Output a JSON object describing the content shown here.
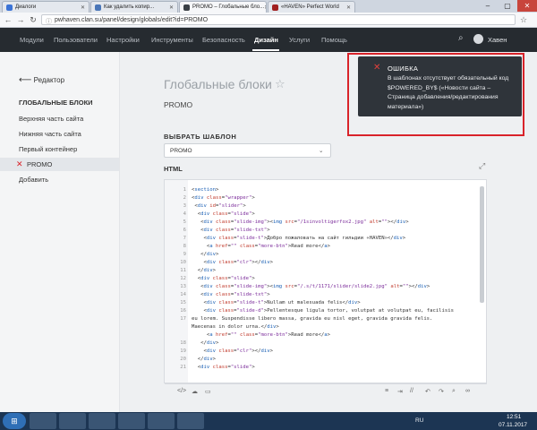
{
  "browser": {
    "tabs": [
      {
        "title": "Диалоги",
        "color": "#3b73d6"
      },
      {
        "title": "Как удалить копир...",
        "color": "#4a76b8"
      },
      {
        "title": "PROMO – Глобальные бло...",
        "color": "#3a3f45"
      },
      {
        "title": "«HAVEN» Perfect World",
        "color": "#a02020"
      }
    ],
    "url": "pwhaven.clan.su/panel/design/globals/edit?id=PROMO"
  },
  "site_nav": {
    "items": [
      "Модули",
      "Пользователи",
      "Настройки",
      "Инструменты",
      "Безопасность",
      "Дизайн",
      "Услуги",
      "Помощь"
    ],
    "active_index": 5,
    "user_name": "Хавен"
  },
  "sidebar": {
    "back_label": "Редактор",
    "section_title": "ГЛОБАЛЬНЫЕ БЛОКИ",
    "items": [
      "Верхняя часть сайта",
      "Нижняя часть сайта",
      "Первый контейнер",
      "PROMO",
      "Добавить"
    ],
    "active_index": 3
  },
  "main": {
    "title": "Глобальные блоки",
    "subtitle": "PROMO",
    "template_label": "ВЫБРАТЬ ШАБЛОН",
    "template_value": "PROMO",
    "html_label": "HTML"
  },
  "editor": {
    "line_numbers": [
      "1",
      "2",
      "3",
      "4",
      "5",
      "6",
      "7",
      "8",
      "9",
      "10",
      "11",
      "12",
      "13",
      "14",
      "15",
      "16",
      "17",
      "",
      "",
      "18",
      "19",
      "20",
      "21"
    ]
  },
  "toast": {
    "title": "ОШИБКА",
    "message": "В шаблонах отсутствует обязательный код $POWERED_BY$ («Новости сайта – Страница добавления/редактирования материала»)"
  },
  "taskbar": {
    "lang": "RU",
    "time": "12:51",
    "date": "07.11.2017"
  },
  "colors": {
    "nav_bg": "#262b30",
    "toast_bg": "#2f343a",
    "error_red": "#d9232a",
    "taskbar_bg": "#1c3553"
  }
}
